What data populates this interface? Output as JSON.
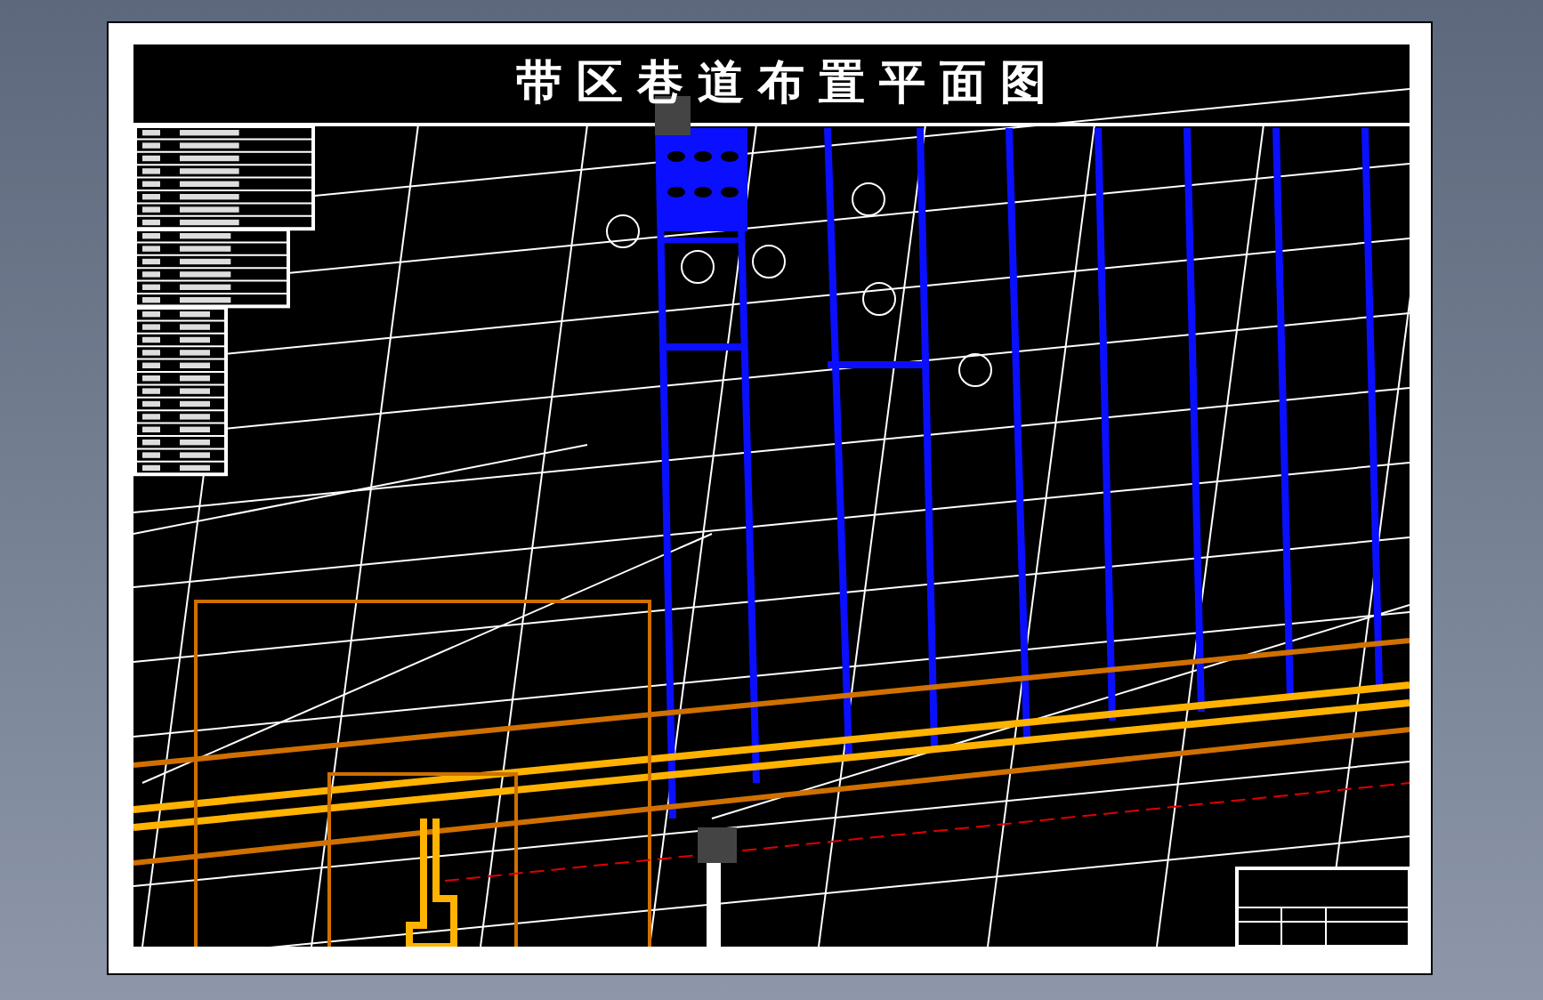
{
  "drawing": {
    "title": "带区巷道布置平面图"
  }
}
